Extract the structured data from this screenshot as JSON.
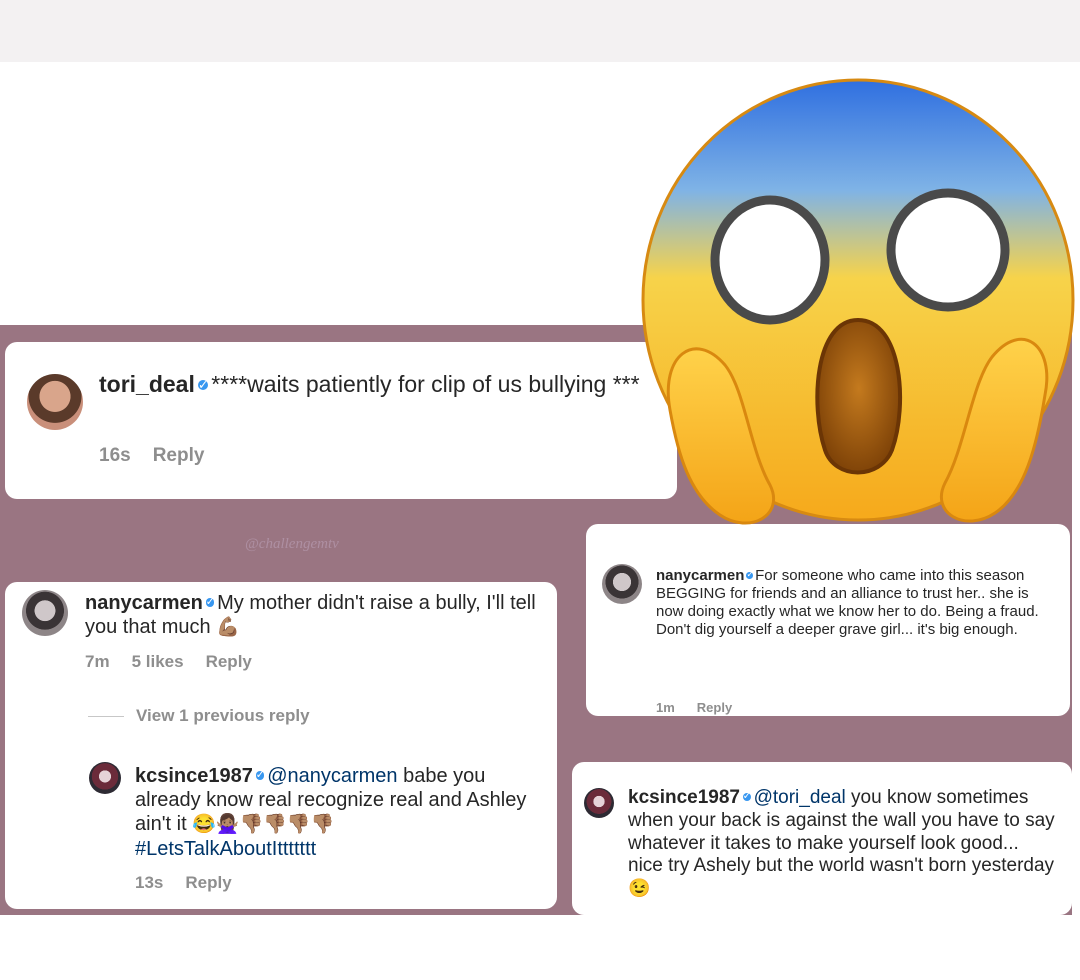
{
  "watermark": "@challengemtv",
  "comments": {
    "tori": {
      "username": "tori_deal",
      "text": "****waits patiently for clip of us bullying ***",
      "time": "16s",
      "reply": "Reply"
    },
    "nany_left": {
      "username": "nanycarmen",
      "text": "My mother didn't raise a bully, I'll tell you that much",
      "emoji": "💪🏽",
      "time": "7m",
      "likes": "5 likes",
      "reply": "Reply",
      "view_previous": "View 1 previous reply"
    },
    "kc_left": {
      "username": "kcsince1987",
      "mention": "@nanycarmen",
      "text": "babe you already know real recognize real and Ashley ain't it",
      "emojis": "😂🙅🏽‍♀️👎🏽👎🏽👎🏽👎🏽",
      "hashtag": "#LetsTalkAboutIttttttt",
      "time": "13s",
      "reply": "Reply"
    },
    "nany_right": {
      "username": "nanycarmen",
      "text": "For someone who came into this season BEGGING for friends and an alliance to trust her.. she is now doing exactly what we know her to do. Being a fraud. Don't dig yourself a deeper grave girl... it's big enough.",
      "time": "1m",
      "reply": "Reply"
    },
    "kc_right": {
      "username": "kcsince1987",
      "mention": "@tori_deal",
      "text": "you know sometimes when your back is against the wall you have to say whatever it takes to make yourself look good... nice try Ashely but the world wasn't born yesterday",
      "emoji": "😉"
    }
  },
  "icons": [
    "verified-badge-icon",
    "screaming-face-emoji-icon",
    "avatar-icon"
  ],
  "colors": {
    "collage_bg": "#9a7582",
    "verified": "#3897f0",
    "meta_gray": "#8e8e8e"
  }
}
